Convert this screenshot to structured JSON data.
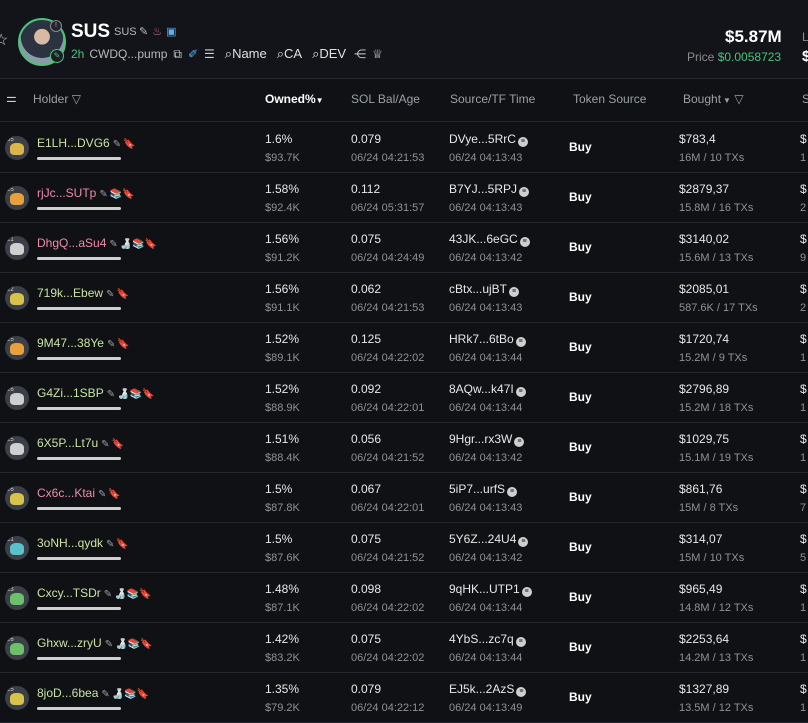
{
  "header": {
    "symbol": "SUS",
    "name": "SUS",
    "age": "2h",
    "address": "CWDQ...pump",
    "search_name": "Name",
    "search_ca": "CA",
    "search_dev": "DEV",
    "market_cap": "$5.87M",
    "price_label": "Price",
    "price_value": "$0.0058723",
    "cut_label_1": "L",
    "cut_label_2": "$"
  },
  "columns": {
    "holder": "Holder",
    "owned": "Owned%",
    "sol": "SOL Bal/Age",
    "source": "Source/TF Time",
    "token_source": "Token Source",
    "bought": "Bought",
    "cut": "S"
  },
  "rows": [
    {
      "address": "E1LH...DVG6",
      "addr_color": "#c9e3a6",
      "avatar_color": "#d9b64a",
      "rank": "55",
      "tags": "🔖",
      "owned": "1.6%",
      "owned_usd": "$93.7K",
      "sol": "0.079",
      "sol_age": "06/24 04:21:53",
      "source": "DVye...5RrC",
      "source_time": "06/24 04:13:43",
      "token_source": "Buy",
      "bought": "$783,4",
      "bought_sub": "16M / 10 TXs",
      "cut1": "$",
      "cut2": "1"
    },
    {
      "address": "rjJc...SUTp",
      "addr_color": "#f08ca8",
      "avatar_color": "#e8a13a",
      "rank": "25",
      "tags": "📚🔖",
      "owned": "1.58%",
      "owned_usd": "$92.4K",
      "sol": "0.112",
      "sol_age": "06/24 05:31:57",
      "source": "B7YJ...5RPJ",
      "source_time": "06/24 04:13:43",
      "token_source": "Buy",
      "bought": "$2879,37",
      "bought_sub": "15.8M / 16 TXs",
      "cut1": "$",
      "cut2": "2"
    },
    {
      "address": "DhgQ...aSu4",
      "addr_color": "#f08ca8",
      "avatar_color": "#cfcfcf",
      "rank": "21",
      "tags": "🍶📚🔖",
      "owned": "1.56%",
      "owned_usd": "$91.2K",
      "sol": "0.075",
      "sol_age": "06/24 04:24:49",
      "source": "43JK...6eGC",
      "source_time": "06/24 04:13:42",
      "token_source": "Buy",
      "bought": "$3140,02",
      "bought_sub": "15.6M / 13 TXs",
      "cut1": "$",
      "cut2": "9"
    },
    {
      "address": "719k...Ebew",
      "addr_color": "#c9e3a6",
      "avatar_color": "#d9c24a",
      "rank": "22",
      "tags": "🔖",
      "owned": "1.56%",
      "owned_usd": "$91.1K",
      "sol": "0.062",
      "sol_age": "06/24 04:21:53",
      "source": "cBtx...ujBT",
      "source_time": "06/24 04:13:43",
      "token_source": "Buy",
      "bought": "$2085,01",
      "bought_sub": "587.6K / 17 TXs",
      "cut1": "$",
      "cut2": "2"
    },
    {
      "address": "9M47...38Ye",
      "addr_color": "#c9e3a6",
      "avatar_color": "#e8a13a",
      "rank": "25",
      "tags": "🔖",
      "owned": "1.52%",
      "owned_usd": "$89.1K",
      "sol": "0.125",
      "sol_age": "06/24 04:22:02",
      "source": "HRk7...6tBo",
      "source_time": "06/24 04:13:44",
      "token_source": "Buy",
      "bought": "$1720,74",
      "bought_sub": "15.2M / 9 TXs",
      "cut1": "$",
      "cut2": "1"
    },
    {
      "address": "G4Zi...1SBP",
      "addr_color": "#c9e3a6",
      "avatar_color": "#cfcfcf",
      "rank": "26",
      "tags": "🍶📚🔖",
      "owned": "1.52%",
      "owned_usd": "$88.9K",
      "sol": "0.092",
      "sol_age": "06/24 04:22:01",
      "source": "8AQw...k47I",
      "source_time": "06/24 04:13:44",
      "token_source": "Buy",
      "bought": "$2796,89",
      "bought_sub": "15.2M / 18 TXs",
      "cut1": "$",
      "cut2": "1"
    },
    {
      "address": "6X5P...Lt7u",
      "addr_color": "#c9e3a6",
      "avatar_color": "#cfcfcf",
      "rank": "25",
      "tags": "🔖",
      "owned": "1.51%",
      "owned_usd": "$88.4K",
      "sol": "0.056",
      "sol_age": "06/24 04:21:52",
      "source": "9Hgr...rx3W",
      "source_time": "06/24 04:13:42",
      "token_source": "Buy",
      "bought": "$1029,75",
      "bought_sub": "15.1M / 19 TXs",
      "cut1": "$",
      "cut2": "1"
    },
    {
      "address": "Cx6c...Ktai",
      "addr_color": "#f08ca8",
      "avatar_color": "#d9c24a",
      "rank": "26",
      "tags": "🔖",
      "owned": "1.5%",
      "owned_usd": "$87.8K",
      "sol": "0.067",
      "sol_age": "06/24 04:22:01",
      "source": "5iP7...urfS",
      "source_time": "06/24 04:13:43",
      "token_source": "Buy",
      "bought": "$861,76",
      "bought_sub": "15M / 8 TXs",
      "cut1": "$",
      "cut2": "7"
    },
    {
      "address": "3oNH...qydk",
      "addr_color": "#c9e3a6",
      "avatar_color": "#58c2c8",
      "rank": "21",
      "tags": "🔖",
      "owned": "1.5%",
      "owned_usd": "$87.6K",
      "sol": "0.075",
      "sol_age": "06/24 04:21:52",
      "source": "5Y6Z...24U4",
      "source_time": "06/24 04:13:42",
      "token_source": "Buy",
      "bought": "$314,07",
      "bought_sub": "15M / 10 TXs",
      "cut1": "$",
      "cut2": "5"
    },
    {
      "address": "Cxcy...TSDr",
      "addr_color": "#c9e3a6",
      "avatar_color": "#6cc06a",
      "rank": "23",
      "tags": "🍶📚🔖",
      "owned": "1.48%",
      "owned_usd": "$87.1K",
      "sol": "0.098",
      "sol_age": "06/24 04:22:02",
      "source": "9qHK...UTP1",
      "source_time": "06/24 04:13:44",
      "token_source": "Buy",
      "bought": "$965,49",
      "bought_sub": "14.8M / 12 TXs",
      "cut1": "$",
      "cut2": "1"
    },
    {
      "address": "Ghxw...zryU",
      "addr_color": "#c9e3a6",
      "avatar_color": "#6cc06a",
      "rank": "26",
      "tags": "🍶📚🔖",
      "owned": "1.42%",
      "owned_usd": "$83.2K",
      "sol": "0.075",
      "sol_age": "06/24 04:22:02",
      "source": "4YbS...zc7q",
      "source_time": "06/24 04:13:44",
      "token_source": "Buy",
      "bought": "$2253,64",
      "bought_sub": "14.2M / 13 TXs",
      "cut1": "$",
      "cut2": "1"
    },
    {
      "address": "8joD...6bea",
      "addr_color": "#c9e3a6",
      "avatar_color": "#d9c24a",
      "rank": "25",
      "tags": "🍶📚🔖",
      "owned": "1.35%",
      "owned_usd": "$79.2K",
      "sol": "0.079",
      "sol_age": "06/24 04:22:12",
      "source": "EJ5k...2AzS",
      "source_time": "06/24 04:13:49",
      "token_source": "Buy",
      "bought": "$1327,89",
      "bought_sub": "13.5M / 12 TXs",
      "cut1": "$",
      "cut2": "1"
    }
  ]
}
